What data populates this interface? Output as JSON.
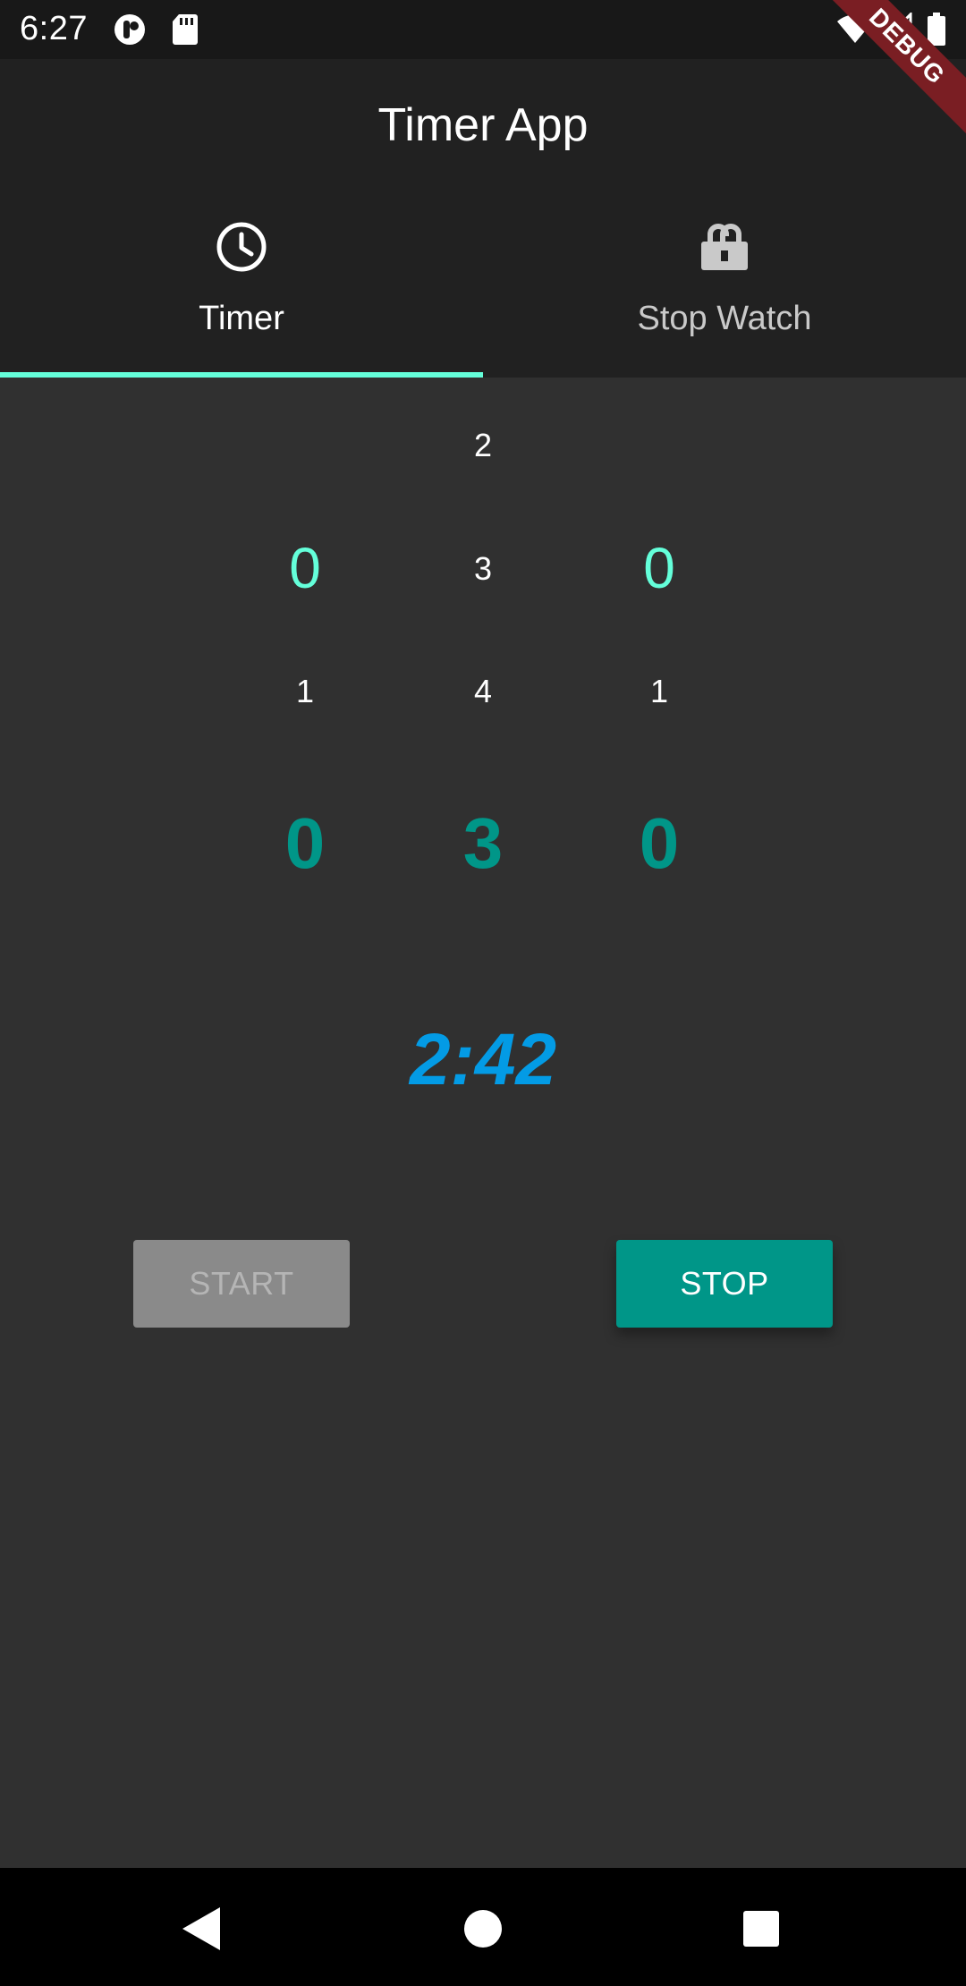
{
  "status_bar": {
    "time": "6:27",
    "left_icons": [
      "notification-icon",
      "sd-card-icon"
    ],
    "right_icons": [
      "wifi-icon",
      "signal-icon",
      "battery-icon"
    ]
  },
  "debug_banner": "DEBUG",
  "app_bar": {
    "title": "Timer App"
  },
  "tabs": [
    {
      "label": "Timer",
      "icon": "clock-icon",
      "selected": true
    },
    {
      "label": "Stop Watch",
      "icon": "lock-open-icon",
      "selected": false
    }
  ],
  "picker": {
    "hours": {
      "selected": "0",
      "below": "1"
    },
    "minutes": {
      "above": "2",
      "selected": "3",
      "below": "4"
    },
    "seconds": {
      "selected": "0",
      "below": "1"
    }
  },
  "selected_digits": {
    "hours": "0",
    "minutes": "3",
    "seconds": "0"
  },
  "countdown": "2:42",
  "buttons": {
    "start": "START",
    "stop": "STOP"
  },
  "nav": [
    "back-icon",
    "home-icon",
    "recents-icon"
  ],
  "colors": {
    "accent": "#64ffda",
    "primary": "#009688",
    "countdown": "#039be5",
    "background": "#303030",
    "app_bar": "#212121"
  }
}
